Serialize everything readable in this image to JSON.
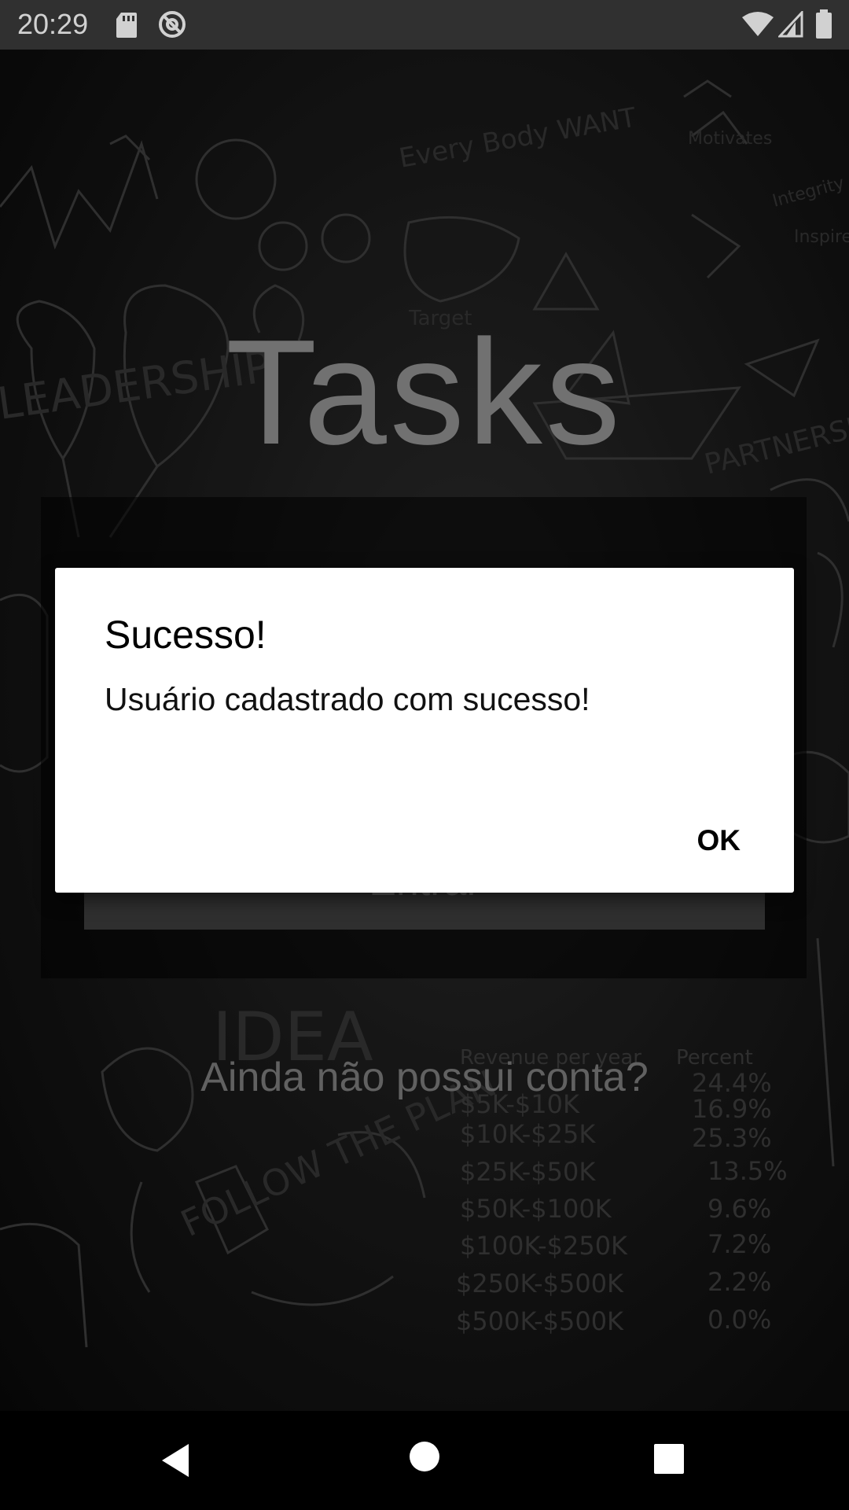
{
  "status_bar": {
    "time": "20:29",
    "icons": [
      "sd-card-icon",
      "sync-icon",
      "wifi-icon",
      "signal-icon",
      "battery-icon"
    ]
  },
  "app": {
    "title": "Tasks",
    "login_button_label": "Entrar",
    "signup_prompt": "Ainda não possui conta?",
    "background_doodle_words": [
      "LEADERSHIP",
      "Target",
      "Every Body WANT",
      "Motivates",
      "Integrity",
      "Inspires",
      "PARTNERSHIP",
      "IDEA",
      "FOLLOW THE PLAN"
    ],
    "background_table": {
      "header": [
        "Revenue per year",
        "Percent"
      ],
      "rows": [
        [
          "$5K-$10K",
          "24.4%"
        ],
        [
          "$10K-$25K",
          "16.9%"
        ],
        [
          "$25K-$50K",
          "25.3%"
        ],
        [
          "$50K-$100K",
          "13.5%"
        ],
        [
          "$100K-$250K",
          "9.6%"
        ],
        [
          "$250K-$500K",
          "7.2%"
        ],
        [
          "$500K-$500K",
          "2.2%"
        ],
        [
          "",
          "0.0%"
        ]
      ]
    }
  },
  "dialog": {
    "title": "Sucesso!",
    "message": "Usuário cadastrado com sucesso!",
    "ok_label": "OK"
  },
  "nav_bar": {
    "icons": [
      "back-icon",
      "home-icon",
      "recents-icon"
    ]
  },
  "colors": {
    "status_bar_bg": "#3b3b3b",
    "dialog_bg": "#ffffff",
    "app_title": "#8a8a8a"
  }
}
